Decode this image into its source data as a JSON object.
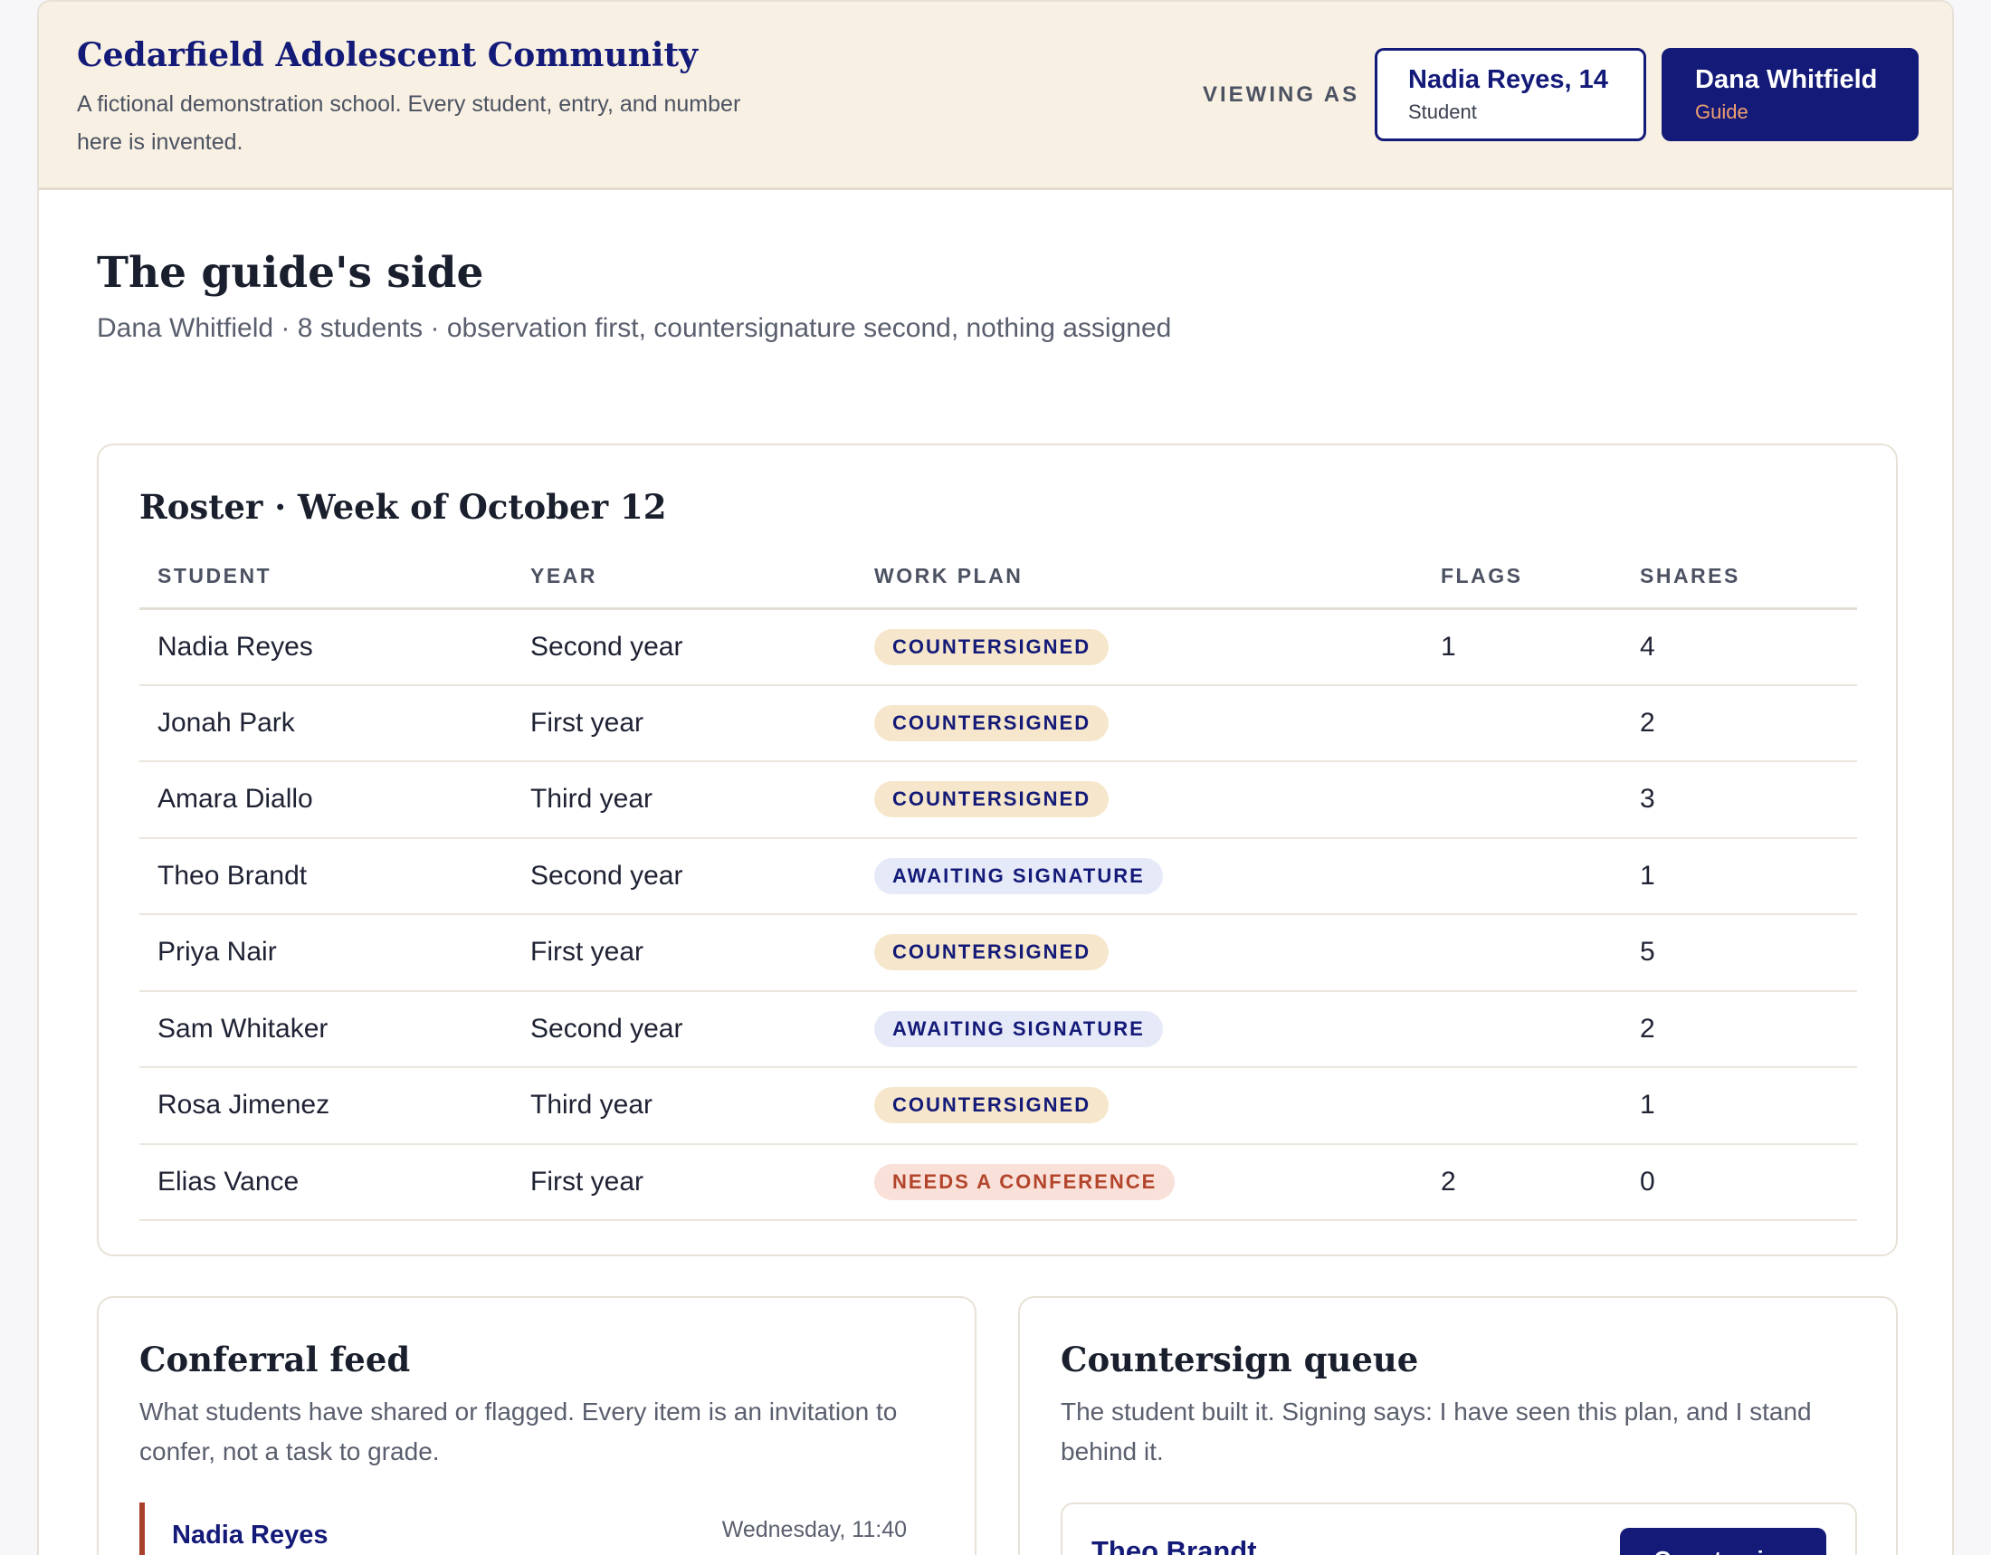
{
  "header": {
    "school_name": "Cedarfield Adolescent Community",
    "school_desc": "A fictional demonstration school. Every student, entry, and number here is invented.",
    "viewing_as": "VIEWING AS",
    "personas": [
      {
        "name": "Nadia Reyes, 14",
        "role": "Student"
      },
      {
        "name": "Dana Whitfield",
        "role": "Guide"
      }
    ]
  },
  "page": {
    "title": "The guide's side",
    "subtitle": "Dana Whitfield · 8 students · observation first, countersignature second, nothing assigned"
  },
  "roster": {
    "title": "Roster · Week of October 12",
    "columns": [
      "STUDENT",
      "YEAR",
      "WORK PLAN",
      "FLAGS",
      "SHARES"
    ],
    "rows": [
      {
        "student": "Nadia Reyes",
        "year": "Second year",
        "plan": "COUNTERSIGNED",
        "status": "countersigned",
        "flags": "1",
        "shares": "4"
      },
      {
        "student": "Jonah Park",
        "year": "First year",
        "plan": "COUNTERSIGNED",
        "status": "countersigned",
        "flags": "",
        "shares": "2"
      },
      {
        "student": "Amara Diallo",
        "year": "Third year",
        "plan": "COUNTERSIGNED",
        "status": "countersigned",
        "flags": "",
        "shares": "3"
      },
      {
        "student": "Theo Brandt",
        "year": "Second year",
        "plan": "AWAITING SIGNATURE",
        "status": "awaiting",
        "flags": "",
        "shares": "1"
      },
      {
        "student": "Priya Nair",
        "year": "First year",
        "plan": "COUNTERSIGNED",
        "status": "countersigned",
        "flags": "",
        "shares": "5"
      },
      {
        "student": "Sam Whitaker",
        "year": "Second year",
        "plan": "AWAITING SIGNATURE",
        "status": "awaiting",
        "flags": "",
        "shares": "2"
      },
      {
        "student": "Rosa Jimenez",
        "year": "Third year",
        "plan": "COUNTERSIGNED",
        "status": "countersigned",
        "flags": "",
        "shares": "1"
      },
      {
        "student": "Elias Vance",
        "year": "First year",
        "plan": "NEEDS A CONFERENCE",
        "status": "conference",
        "flags": "2",
        "shares": "0"
      }
    ]
  },
  "feed": {
    "title": "Conferral feed",
    "desc": "What students have shared or flagged. Every item is an invitation to confer, not a task to grade.",
    "items": [
      {
        "name": "Nadia Reyes",
        "time": "Wednesday, 11:40"
      }
    ]
  },
  "queue": {
    "title": "Countersign queue",
    "desc": "The student built it. Signing says: I have seen this plan, and I stand behind it.",
    "items": [
      {
        "name": "Theo Brandt",
        "button": "Countersign"
      }
    ]
  },
  "colors": {
    "navy": "#141a78",
    "cream": "#f8f1e3",
    "rust": "#a8402c",
    "accent_orange": "#f0a070"
  }
}
